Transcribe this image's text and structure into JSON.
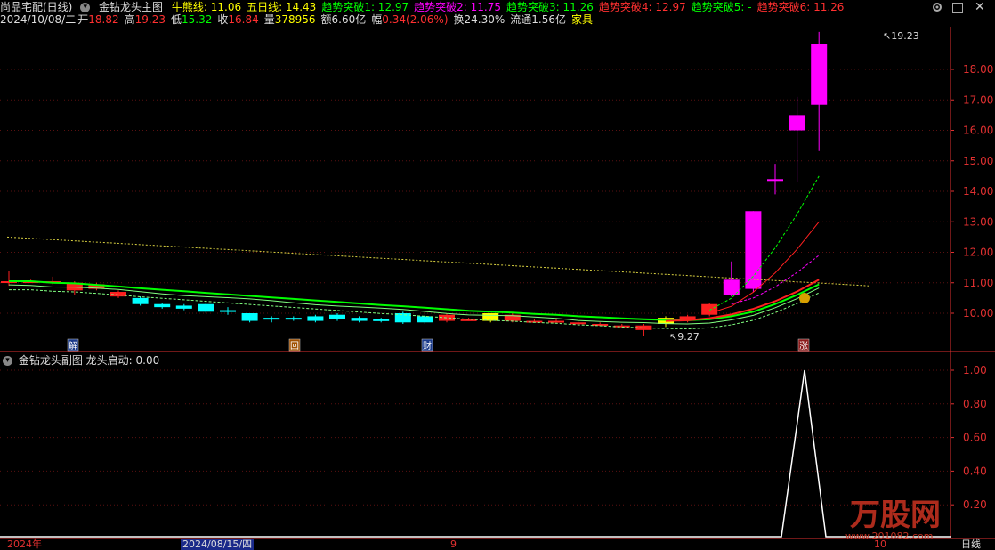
{
  "header": {
    "title": "尚品宅配(日线)",
    "indicator_name": "金钻龙头主图",
    "lines": [
      {
        "label": "牛熊线:",
        "value": "11.06",
        "color": "#ffff00"
      },
      {
        "label": "五日线:",
        "value": "14.43",
        "color": "#ffff00"
      },
      {
        "label": "趋势突破1:",
        "value": "12.97",
        "color": "#00ff00"
      },
      {
        "label": "趋势突破2:",
        "value": "11.75",
        "color": "#ff00ff"
      },
      {
        "label": "趋势突破3:",
        "value": "11.26",
        "color": "#00ff00"
      },
      {
        "label": "趋势突破4:",
        "value": "12.97",
        "color": "#ff3030"
      },
      {
        "label": "趋势突破5:",
        "value": "-",
        "color": "#00ff00"
      },
      {
        "label": "趋势突破6:",
        "value": "11.26",
        "color": "#ff3030"
      }
    ],
    "date": "2024/10/08/二",
    "open_label": "开",
    "open": "18.82",
    "high_label": "高",
    "high": "19.23",
    "low_label": "低",
    "low": "15.32",
    "close_label": "收",
    "close": "16.84",
    "vol_label": "量",
    "vol": "378956",
    "amount": "额6.60亿",
    "change_label": "幅",
    "change": "0.34(2.06%)",
    "turnover": "换24.30%",
    "float": "流通1.56亿",
    "sector": "家具"
  },
  "sub": {
    "name": "金钻龙头副图",
    "line_label": "龙头启动:",
    "line_value": "0.00"
  },
  "price_axis": [
    "18.00",
    "17.00",
    "16.00",
    "15.00",
    "14.00",
    "13.00",
    "12.00",
    "11.00",
    "10.00"
  ],
  "sub_axis": [
    "1.00",
    "0.80",
    "0.60",
    "0.40",
    "0.20"
  ],
  "annotations": {
    "high_mark": "19.23",
    "low_mark": "9.27",
    "jie": "解",
    "hui": "回",
    "cai": "财",
    "zhang": "涨"
  },
  "bottom": {
    "year": "2024年",
    "date_box": "2024/08/15/四",
    "month9": "9",
    "month10": "10",
    "period": "日线"
  },
  "watermark": {
    "brand": "万股网",
    "url": "www.201082.com"
  },
  "colors": {
    "up": "#ff2020",
    "down": "#00ffff",
    "magenta": "#ff00ff",
    "yellow": "#ffff00",
    "green": "#00ff00",
    "axis": "#e03030"
  },
  "candles": [
    {
      "o": 11.05,
      "c": 11.0,
      "h": 11.4,
      "l": 10.9,
      "t": "d"
    },
    {
      "o": 11.05,
      "c": 11.05,
      "h": 11.1,
      "l": 11.0,
      "t": "d"
    },
    {
      "o": 11.0,
      "c": 11.05,
      "h": 11.2,
      "l": 10.95,
      "t": "u"
    },
    {
      "o": 11.0,
      "c": 10.75,
      "h": 11.05,
      "l": 10.6,
      "t": "d"
    },
    {
      "o": 10.95,
      "c": 10.8,
      "h": 11.0,
      "l": 10.75,
      "t": "d"
    },
    {
      "o": 10.7,
      "c": 10.55,
      "h": 10.75,
      "l": 10.5,
      "t": "d"
    },
    {
      "o": 10.5,
      "c": 10.3,
      "h": 10.55,
      "l": 10.25,
      "t": "c"
    },
    {
      "o": 10.3,
      "c": 10.2,
      "h": 10.35,
      "l": 10.15,
      "t": "c"
    },
    {
      "o": 10.25,
      "c": 10.15,
      "h": 10.3,
      "l": 10.1,
      "t": "c"
    },
    {
      "o": 10.3,
      "c": 10.05,
      "h": 10.35,
      "l": 10.0,
      "t": "c"
    },
    {
      "o": 10.1,
      "c": 10.1,
      "h": 10.2,
      "l": 9.95,
      "t": "c"
    },
    {
      "o": 10.0,
      "c": 9.75,
      "h": 10.0,
      "l": 9.7,
      "t": "c"
    },
    {
      "o": 9.85,
      "c": 9.8,
      "h": 9.9,
      "l": 9.7,
      "t": "c"
    },
    {
      "o": 9.85,
      "c": 9.8,
      "h": 9.9,
      "l": 9.75,
      "t": "c"
    },
    {
      "o": 9.9,
      "c": 9.75,
      "h": 9.95,
      "l": 9.7,
      "t": "c"
    },
    {
      "o": 9.95,
      "c": 9.8,
      "h": 10.0,
      "l": 9.75,
      "t": "c"
    },
    {
      "o": 9.85,
      "c": 9.75,
      "h": 9.9,
      "l": 9.7,
      "t": "c"
    },
    {
      "o": 9.8,
      "c": 9.75,
      "h": 9.85,
      "l": 9.7,
      "t": "c"
    },
    {
      "o": 10.0,
      "c": 9.7,
      "h": 10.05,
      "l": 9.65,
      "t": "c"
    },
    {
      "o": 9.9,
      "c": 9.7,
      "h": 9.95,
      "l": 9.65,
      "t": "c"
    },
    {
      "o": 9.75,
      "c": 9.95,
      "h": 10.0,
      "l": 9.7,
      "t": "u"
    },
    {
      "o": 9.8,
      "c": 9.8,
      "h": 9.85,
      "l": 9.75,
      "t": "u"
    },
    {
      "o": 9.75,
      "c": 10.0,
      "h": 10.0,
      "l": 9.7,
      "t": "y"
    },
    {
      "o": 9.75,
      "c": 9.95,
      "h": 10.0,
      "l": 9.7,
      "t": "u"
    },
    {
      "o": 9.75,
      "c": 9.75,
      "h": 9.8,
      "l": 9.7,
      "t": "u"
    },
    {
      "o": 9.75,
      "c": 9.75,
      "h": 9.8,
      "l": 9.7,
      "t": "u"
    },
    {
      "o": 9.7,
      "c": 9.7,
      "h": 9.75,
      "l": 9.65,
      "t": "u"
    },
    {
      "o": 9.65,
      "c": 9.65,
      "h": 9.7,
      "l": 9.6,
      "t": "u"
    },
    {
      "o": 9.6,
      "c": 9.6,
      "h": 9.65,
      "l": 9.55,
      "t": "u"
    },
    {
      "o": 9.6,
      "c": 9.45,
      "h": 9.65,
      "l": 9.27,
      "t": "u"
    },
    {
      "o": 9.65,
      "c": 9.85,
      "h": 9.9,
      "l": 9.55,
      "t": "y"
    },
    {
      "o": 9.75,
      "c": 9.9,
      "h": 9.95,
      "l": 9.7,
      "t": "u"
    },
    {
      "o": 9.95,
      "c": 10.3,
      "h": 10.35,
      "l": 9.9,
      "t": "u"
    },
    {
      "o": 10.6,
      "c": 11.1,
      "h": 11.7,
      "l": 10.55,
      "t": "m"
    },
    {
      "o": 10.8,
      "c": 13.35,
      "h": 13.35,
      "l": 10.7,
      "t": "m"
    },
    {
      "o": 14.4,
      "c": 14.4,
      "h": 14.9,
      "l": 13.9,
      "t": "m"
    },
    {
      "o": 16.0,
      "c": 16.5,
      "h": 17.1,
      "l": 14.3,
      "t": "m"
    },
    {
      "o": 16.84,
      "c": 18.82,
      "h": 19.23,
      "l": 15.32,
      "t": "m"
    }
  ]
}
